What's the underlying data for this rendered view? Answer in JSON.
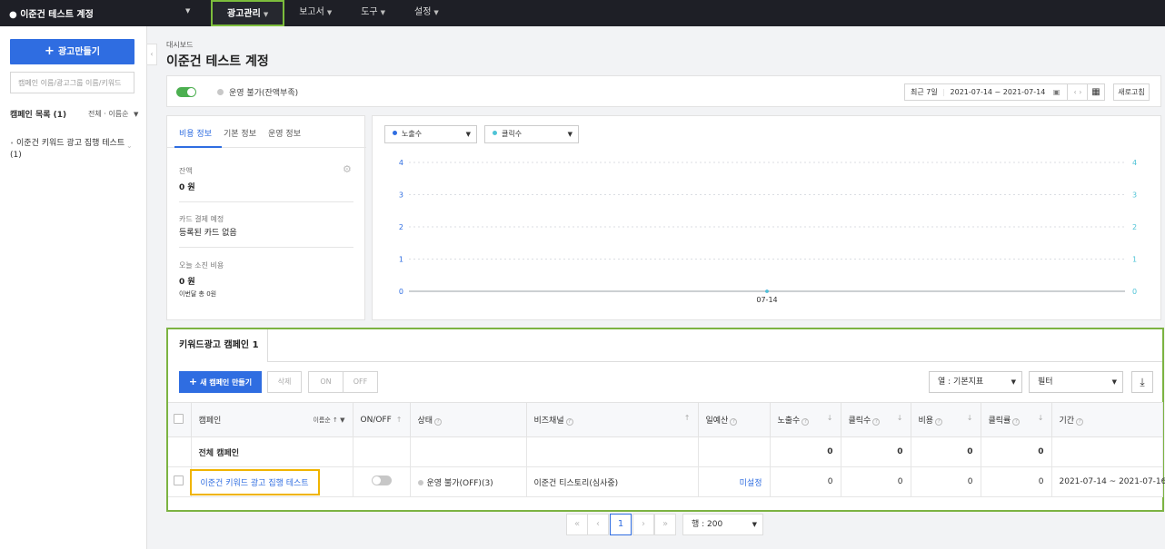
{
  "topbar": {
    "account": "● 이준건 테스트 계정",
    "nav": [
      {
        "label": "광고관리"
      },
      {
        "label": "보고서"
      },
      {
        "label": "도구"
      },
      {
        "label": "설정"
      }
    ]
  },
  "sidebar": {
    "new_button": "광고만들기",
    "search_placeholder": "캠페인 이름/광고그룹 이름/키워드",
    "list_title": "캠페인 목록 (1)",
    "sort_label": "전체 · 이름순",
    "tree_item": "이준건 키워드 광고 집행 테스트 (1)"
  },
  "header": {
    "breadcrumb": "대시보드",
    "title": "이준건 테스트 계정"
  },
  "status": {
    "text": "운영 불가(잔액부족)",
    "period": "최근 7일",
    "date_range": "2021-07-14 ~ 2021-07-14",
    "refresh": "새로고침"
  },
  "info_panel": {
    "tabs": [
      "비용 정보",
      "기본 정보",
      "운영 정보"
    ],
    "balance_label": "잔액",
    "balance_value": "0 원",
    "card_label": "카드 결제 예정",
    "card_value": "등록된 카드 없음",
    "today_label": "오늘 소진 비용",
    "today_value": "0 원",
    "month_note": "이번달 총 0원"
  },
  "chart_controls": {
    "metric1": "노출수",
    "metric2": "클릭수"
  },
  "chart_data": {
    "type": "line",
    "x": [
      "07-14"
    ],
    "series": [
      {
        "name": "노출수",
        "values": [
          0
        ]
      },
      {
        "name": "클릭수",
        "values": [
          0
        ]
      }
    ],
    "ylim": [
      0,
      4
    ],
    "yticks": [
      "0",
      "1",
      "2",
      "3",
      "4"
    ],
    "grid": true,
    "colors": {
      "impressions": "#2f6de1",
      "clicks": "#4ec3d6"
    }
  },
  "campaign_panel": {
    "tab": "키워드광고 캠페인 1",
    "new_campaign": "새 캠페인 만들기",
    "delete": "삭제",
    "on": "ON",
    "off": "OFF",
    "columns_select": "열 : 기본지표",
    "filter_select": "필터",
    "headers": {
      "campaign": "캠페인",
      "campaign_sort": "이름순 ↑",
      "onoff": "ON/OFF",
      "status": "상태",
      "channel": "비즈채널",
      "budget": "일예산",
      "impressions": "노출수",
      "clicks": "클릭수",
      "cost": "비용",
      "ctr": "클릭률",
      "period": "기간"
    },
    "total_row": {
      "name": "전체 캠페인",
      "impressions": "0",
      "clicks": "0",
      "cost": "0",
      "ctr": "0"
    },
    "row": {
      "name": "이준건 키워드 광고 집행 테스트",
      "status": "운영 불가(OFF)(3)",
      "channel": "이준건 티스토리(심사중)",
      "budget": "미설정",
      "impressions": "0",
      "clicks": "0",
      "cost": "0",
      "ctr": "0",
      "period": "2021-07-14 ~ 2021-07-16"
    }
  },
  "pagination": {
    "current": "1",
    "rows": "행 : 200"
  }
}
